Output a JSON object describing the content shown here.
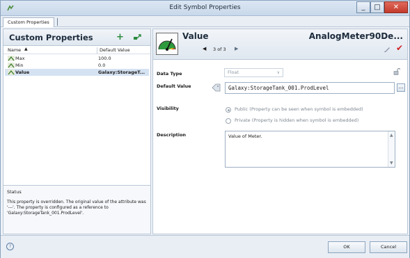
{
  "window": {
    "title": "Edit Symbol Properties",
    "min_label": "_",
    "max_label": "□",
    "close_label": "✕"
  },
  "tabs": [
    {
      "label": "Custom Properties"
    }
  ],
  "left": {
    "title": "Custom Properties",
    "add_icon": "plus-icon",
    "add_symbol": "+",
    "link_icon": "link-reference-icon",
    "columns": {
      "name": "Name",
      "sort_symbol": "▲",
      "default": "Default Value"
    },
    "rows": [
      {
        "name": "Max",
        "value": "100.0"
      },
      {
        "name": "Min",
        "value": "0.0"
      },
      {
        "name": "Value",
        "value": "Galaxy:StorageT..."
      }
    ],
    "selected_row": 2,
    "status": {
      "title": "Status",
      "text": "This property is overridden.  The original value of the attribute was '---'.  The property is configured as a reference to 'Galaxy:StorageTank_001.ProdLevel'."
    }
  },
  "right": {
    "property_name": "Value",
    "nav": {
      "prev": "◀",
      "position": "3 of 3",
      "next": "▶"
    },
    "symbol_name": "AnalogMeter90De...",
    "check_symbol": "✔",
    "labels": {
      "data_type": "Data Type",
      "default_value": "Default Value",
      "visibility": "Visibility",
      "description": "Description"
    },
    "data_type": {
      "value": "Float",
      "arrow": "∨"
    },
    "default_value": "Galaxy:StorageTank_001.ProdLevel",
    "browse_label": "...",
    "visibility": {
      "options": [
        {
          "label": "Public (Property can be seen when symbol is embedded)",
          "selected": true
        },
        {
          "label": "Private (Property is hidden when symbol is embedded)",
          "selected": false
        }
      ]
    },
    "description": "Value of Meter.",
    "scroll": {
      "up": "▲",
      "down": "▼"
    }
  },
  "footer": {
    "help_symbol": "?",
    "ok_label": "OK",
    "cancel_label": "Cancel"
  }
}
